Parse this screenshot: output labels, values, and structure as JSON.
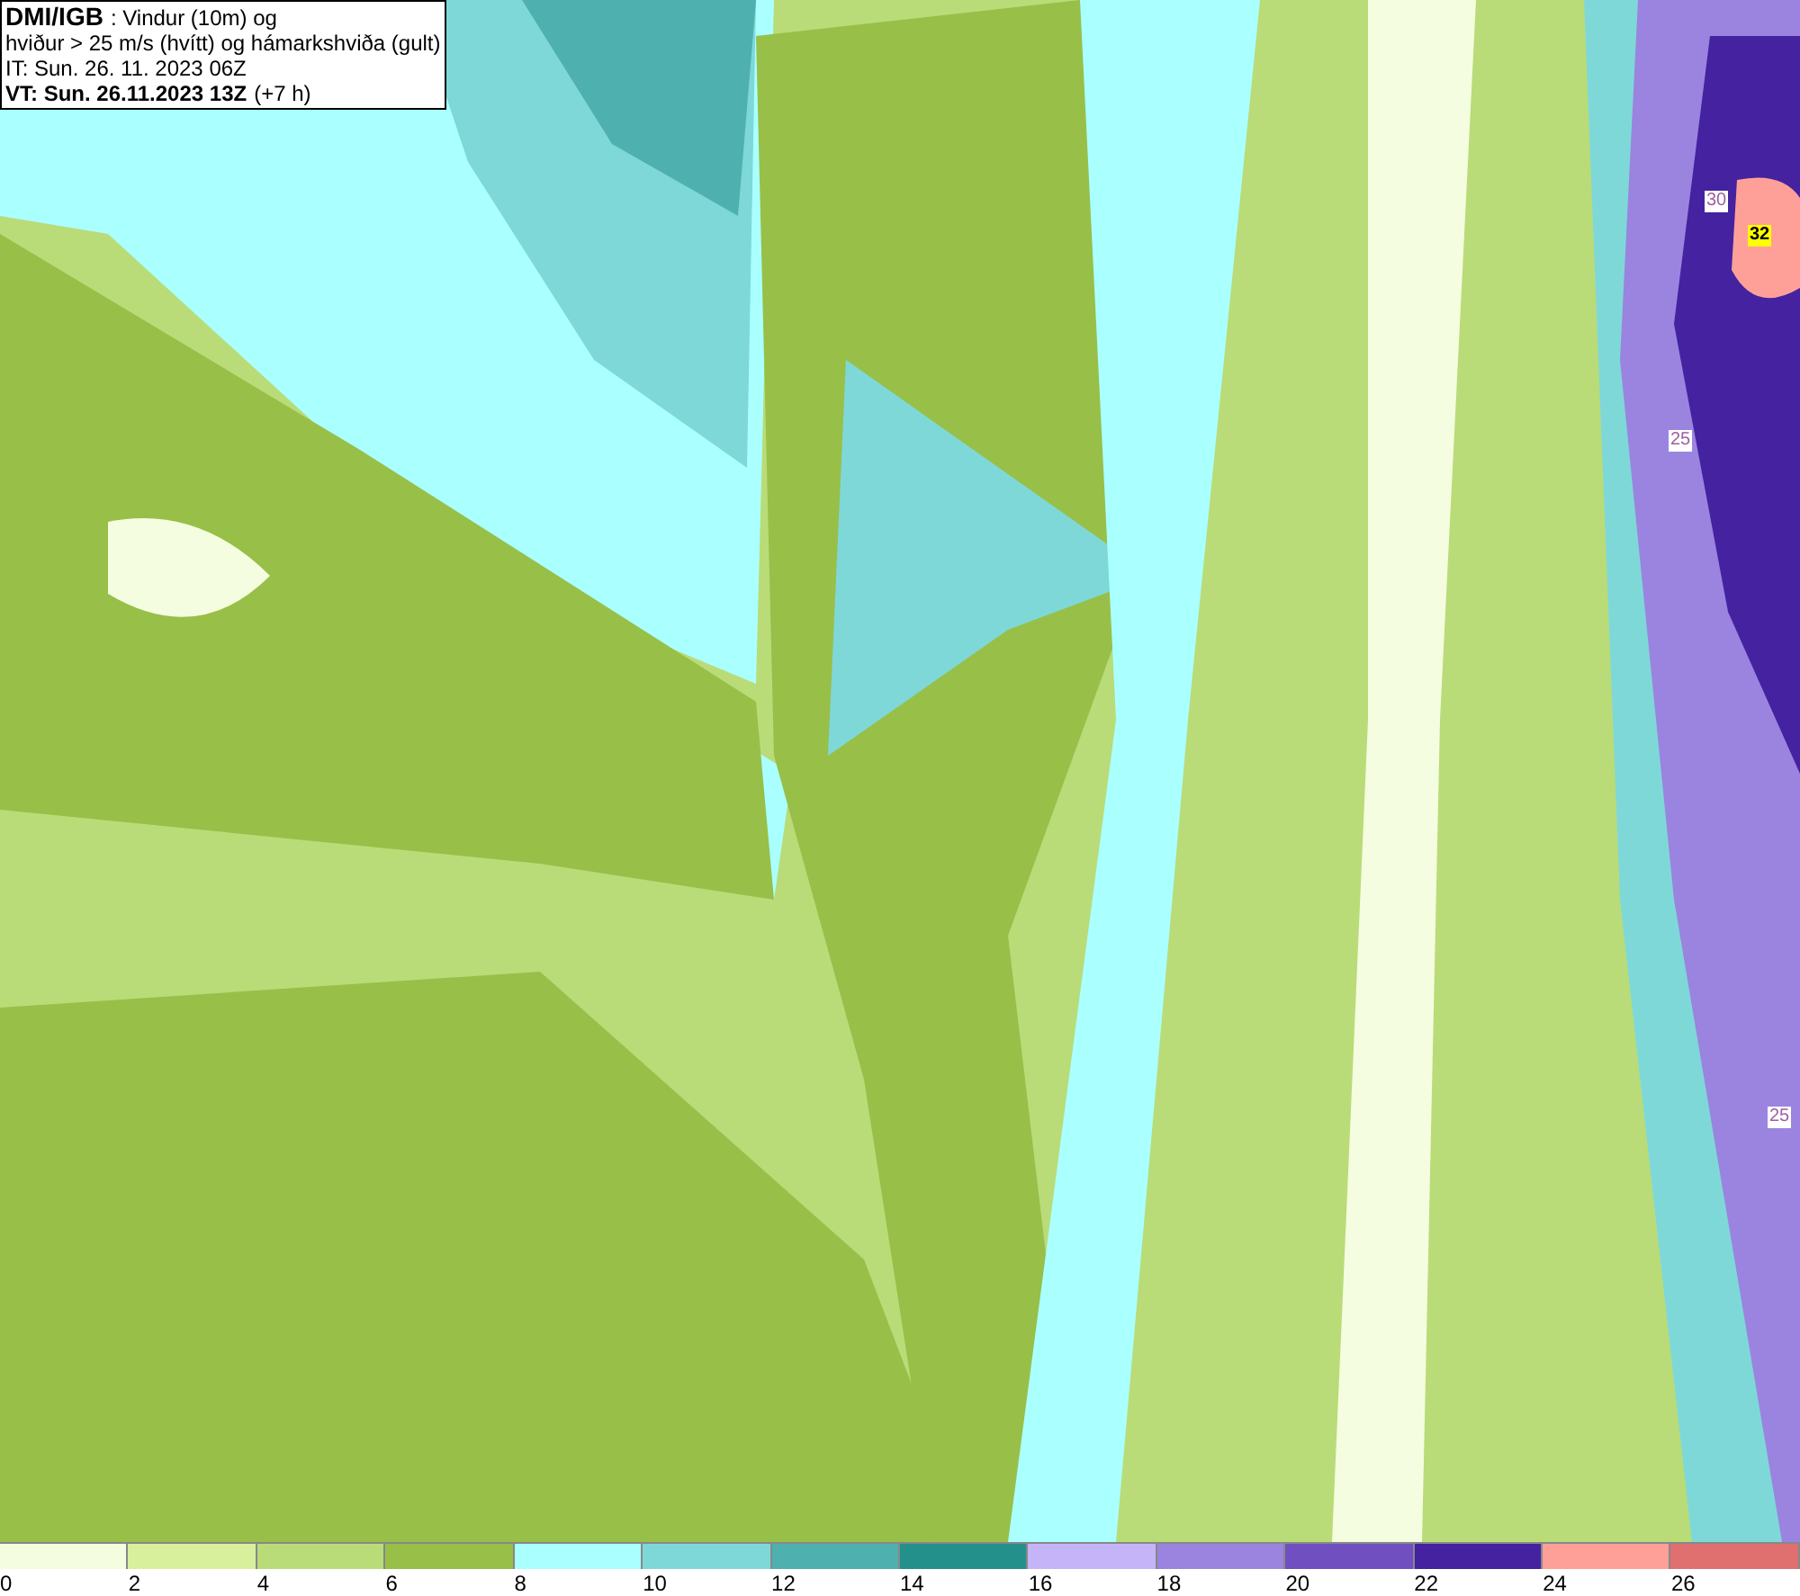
{
  "header": {
    "source": "DMI/IGB",
    "title": ": Vindur (10m) og",
    "subtitle": "hviður > 25 m/s (hvítt) og hámarkshviða (gult)",
    "issue_time": "IT: Sun. 26. 11. 2023 06Z",
    "valid_time": "VT: Sun. 26.11.2023 13Z",
    "lead": "(+7 h)"
  },
  "contour_labels": [
    {
      "text": "30",
      "kind": "gust"
    },
    {
      "text": "32",
      "kind": "max"
    },
    {
      "text": "25",
      "kind": "gust"
    },
    {
      "text": "25",
      "kind": "gust"
    }
  ],
  "legend": [
    {
      "label": "0",
      "color": "#f5fde0"
    },
    {
      "label": "2",
      "color": "#d8f09c"
    },
    {
      "label": "4",
      "color": "#b9dc78"
    },
    {
      "label": "6",
      "color": "#98bf48"
    },
    {
      "label": "8",
      "color": "#aaffff"
    },
    {
      "label": "10",
      "color": "#7fd8d8"
    },
    {
      "label": "12",
      "color": "#4fb0b0"
    },
    {
      "label": "14",
      "color": "#24908c"
    },
    {
      "label": "16",
      "color": "#c6b4f8"
    },
    {
      "label": "18",
      "color": "#9a84e0"
    },
    {
      "label": "20",
      "color": "#7050c0"
    },
    {
      "label": "22",
      "color": "#4422a0"
    },
    {
      "label": "24",
      "color": "#ffa098"
    },
    {
      "label": "26",
      "color": "#e07070"
    }
  ]
}
